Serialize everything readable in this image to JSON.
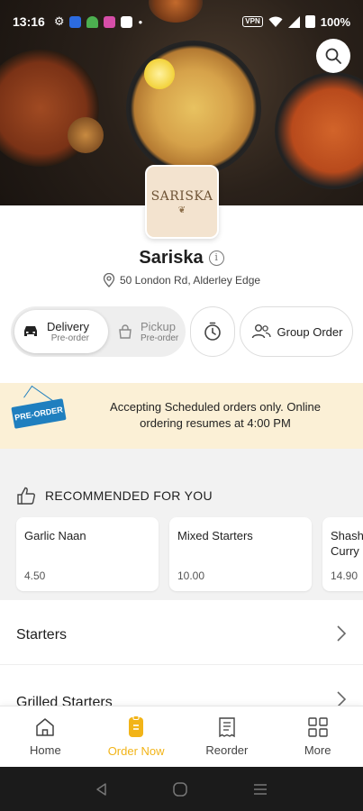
{
  "status_bar": {
    "time": "13:16",
    "battery": "100%",
    "vpn": "VPN"
  },
  "restaurant": {
    "logo_text": "SARISKA",
    "name": "Sariska",
    "address": "50 London Rd, Alderley Edge"
  },
  "order_mode": {
    "delivery_label": "Delivery",
    "delivery_sub": "Pre-order",
    "pickup_label": "Pickup",
    "pickup_sub": "Pre-order",
    "selected": "Delivery"
  },
  "group_order_label": "Group Order",
  "banner": {
    "sign_text": "PRE-ORDER",
    "message": "Accepting Scheduled orders only. Online ordering resumes at 4:00 PM"
  },
  "recommended": {
    "heading": "RECOMMENDED FOR YOU",
    "items": [
      {
        "name": "Garlic Naan",
        "price": "4.50"
      },
      {
        "name": "Mixed Starters",
        "price": "10.00"
      },
      {
        "name": "Shashlik Curry",
        "price": "14.90"
      }
    ]
  },
  "categories": [
    "Starters",
    "Grilled Starters"
  ],
  "bottom_nav": {
    "items": [
      {
        "label": "Home",
        "icon": "home-icon"
      },
      {
        "label": "Order Now",
        "icon": "order-now-icon"
      },
      {
        "label": "Reorder",
        "icon": "receipt-icon"
      },
      {
        "label": "More",
        "icon": "grid-icon"
      }
    ],
    "active": "Order Now"
  },
  "colors": {
    "accent": "#f2b418",
    "banner_bg": "#fbf0d6",
    "sign_blue": "#1f7fbf"
  }
}
